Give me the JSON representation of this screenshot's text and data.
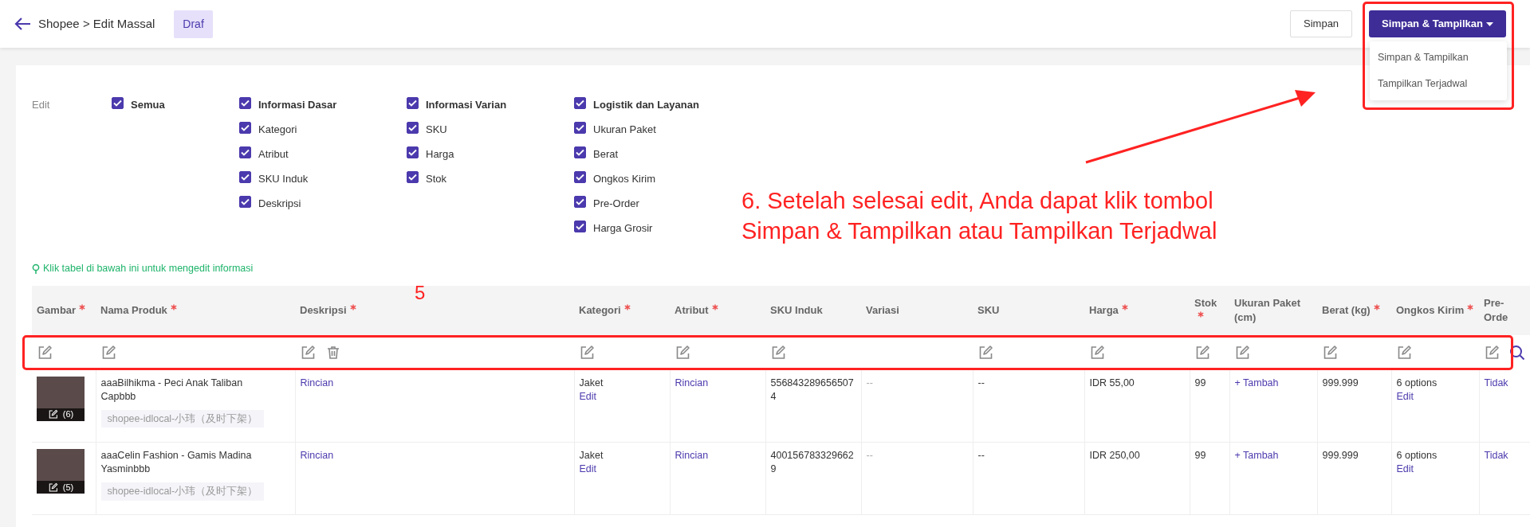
{
  "top_bar": {
    "breadcrumb": "Shopee > Edit Massal",
    "status": "Draf",
    "buttons": [
      {
        "label": "Simpan",
        "kind": "outline"
      },
      {
        "label": "Simpan & Tampilkan",
        "kind": "primary"
      }
    ],
    "menu": [
      {
        "label": "Simpan & Tampilkan"
      },
      {
        "label": "Tampilkan Terjadwal"
      }
    ]
  },
  "edit_filter": {
    "label": "Edit",
    "groups": [
      {
        "label": "Semua",
        "checked": true
      },
      {
        "label": "Informasi Dasar",
        "checked": true,
        "children": [
          {
            "label": "Kategori",
            "checked": true
          },
          {
            "label": "Atribut",
            "checked": true
          },
          {
            "label": "SKU Induk",
            "checked": true
          },
          {
            "label": "Deskripsi",
            "checked": true
          }
        ]
      },
      {
        "label": "Informasi Varian",
        "checked": true,
        "children": [
          {
            "label": "SKU",
            "checked": true
          },
          {
            "label": "Harga",
            "checked": true
          },
          {
            "label": "Stok",
            "checked": true
          }
        ]
      },
      {
        "label": "Logistik dan Layanan",
        "checked": true,
        "children": [
          {
            "label": "Ukuran Paket",
            "checked": true
          },
          {
            "label": "Berat",
            "checked": true
          },
          {
            "label": "Ongkos Kirim",
            "checked": true
          },
          {
            "label": "Pre-Order",
            "checked": true
          },
          {
            "label": "Harga Grosir",
            "checked": true
          }
        ]
      }
    ]
  },
  "hint": "Klik tabel di bawah ini untuk mengedit informasi",
  "table": {
    "columns": [
      {
        "label": "Gambar",
        "required": true,
        "editable": true
      },
      {
        "label": "Nama Produk",
        "required": true,
        "editable": true
      },
      {
        "label": "Deskripsi",
        "required": true,
        "editable": true,
        "deletable": true
      },
      {
        "label": "Kategori",
        "required": true,
        "editable": true
      },
      {
        "label": "Atribut",
        "required": true,
        "editable": true
      },
      {
        "label": "SKU Induk",
        "required": false,
        "editable": true
      },
      {
        "label": "Variasi",
        "required": false,
        "editable": false
      },
      {
        "label": "SKU",
        "required": false,
        "editable": true
      },
      {
        "label": "Harga",
        "required": true,
        "editable": true
      },
      {
        "label": "Stok",
        "required": true,
        "editable": true
      },
      {
        "label": "Ukuran Paket (cm)",
        "required": false,
        "editable": true
      },
      {
        "label": "Berat (kg)",
        "required": true,
        "editable": true
      },
      {
        "label": "Ongkos Kirim",
        "required": true,
        "editable": true
      },
      {
        "label": "Pre-Orde",
        "required": false,
        "editable": true,
        "searchable": true
      }
    ],
    "rows": [
      {
        "cells": [
          {
            "kind": "image",
            "count": "(6)"
          },
          {
            "kind": "product",
            "name": "aaaBilhikma - Peci Anak Taliban Capbbb",
            "tag": "shopee-idlocal-小玮（及时下架）"
          },
          {
            "kind": "link",
            "text": "Rincian"
          },
          {
            "kind": "text_edit",
            "text": "Jaket",
            "link": "Edit"
          },
          {
            "kind": "link",
            "text": "Rincian"
          },
          {
            "kind": "text",
            "text": "5568432896565074"
          },
          {
            "kind": "muted",
            "text": "--"
          },
          {
            "kind": "text",
            "text": "--"
          },
          {
            "kind": "text",
            "text": "IDR 55,00"
          },
          {
            "kind": "text",
            "text": "99"
          },
          {
            "kind": "link",
            "text": "+ Tambah"
          },
          {
            "kind": "text",
            "text": "999.999"
          },
          {
            "kind": "text_edit",
            "text": "6 options",
            "link": "Edit"
          },
          {
            "kind": "link",
            "text": "Tidak"
          }
        ]
      },
      {
        "cells": [
          {
            "kind": "image",
            "count": "(5)"
          },
          {
            "kind": "product",
            "name": "aaaCelin Fashion - Gamis Madina Yasminbbb",
            "tag": "shopee-idlocal-小玮（及时下架）"
          },
          {
            "kind": "link",
            "text": "Rincian"
          },
          {
            "kind": "text_edit",
            "text": "Jaket",
            "link": "Edit"
          },
          {
            "kind": "link",
            "text": "Rincian"
          },
          {
            "kind": "text",
            "text": "4001567833296629"
          },
          {
            "kind": "muted",
            "text": "--"
          },
          {
            "kind": "text",
            "text": "--"
          },
          {
            "kind": "text",
            "text": "IDR 250,00"
          },
          {
            "kind": "text",
            "text": "99"
          },
          {
            "kind": "link",
            "text": "+ Tambah"
          },
          {
            "kind": "text",
            "text": "999.999"
          },
          {
            "kind": "text_edit",
            "text": "6 options",
            "link": "Edit"
          },
          {
            "kind": "link",
            "text": "Tidak"
          }
        ]
      }
    ]
  },
  "annotations": {
    "step_number": "5",
    "instruction": [
      "6. Setelah selesai edit, Anda dapat klik tombol",
      "Simpan & Tampilkan atau Tampilkan Terjadwal"
    ]
  }
}
